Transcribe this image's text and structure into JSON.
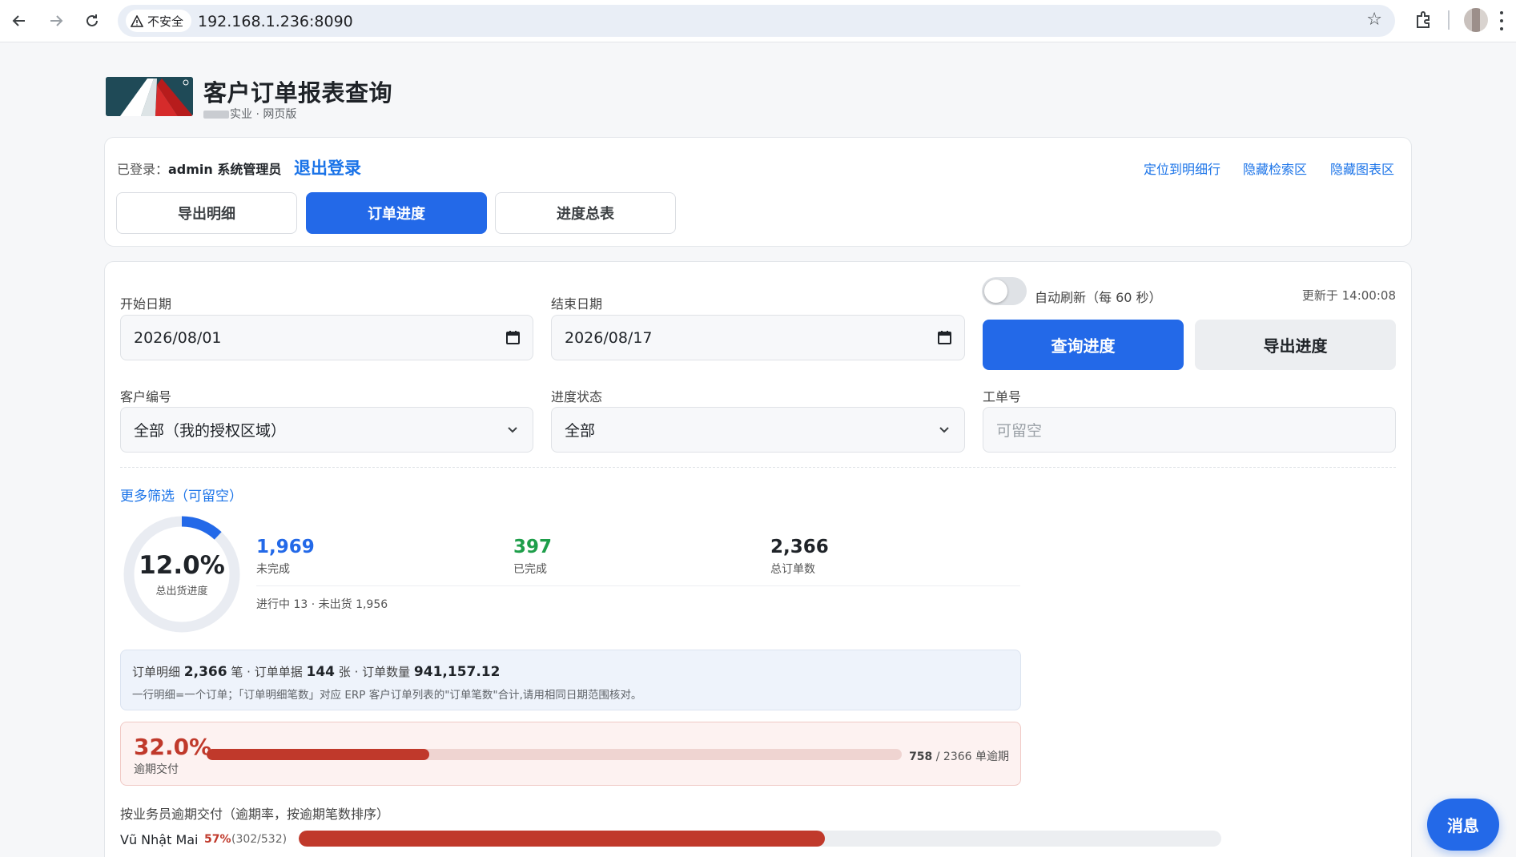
{
  "browser": {
    "security_label": "不安全",
    "url": "192.168.1.236:8090"
  },
  "header": {
    "title": "客户订单报表查询",
    "subtitle": "实业 · 网页版"
  },
  "login": {
    "label": "已登录：",
    "user": "admin 系统管理员",
    "logout": "退出登录"
  },
  "top_links": [
    "定位到明细行",
    "隐藏检索区",
    "隐藏图表区"
  ],
  "tabs": [
    {
      "label": "导出明细",
      "active": false
    },
    {
      "label": "订单进度",
      "active": true
    },
    {
      "label": "进度总表",
      "active": false
    }
  ],
  "form": {
    "start_date_label": "开始日期",
    "start_date": "2026/08/01",
    "end_date_label": "结束日期",
    "end_date": "2026/08/17",
    "auto_refresh_label": "自动刷新（每 60 秒）",
    "updated_at": "更新于 14:00:08",
    "query_button": "查询进度",
    "export_button": "导出进度",
    "customer_label": "客户编号",
    "customer_value": "全部（我的授权区域）",
    "status_label": "进度状态",
    "status_value": "全部",
    "work_order_label": "工单号",
    "work_order_placeholder": "可留空",
    "more_filters": "更多筛选（可留空）"
  },
  "summary": {
    "overall_pct": "12.0%",
    "overall_fraction": 0.12,
    "overall_label": "总出货进度",
    "stats": [
      {
        "value": "1,969",
        "label": "未完成",
        "color": "#2369e8"
      },
      {
        "value": "397",
        "label": "已完成",
        "color": "#1e9e4a"
      },
      {
        "value": "2,366",
        "label": "总订单数",
        "color": "#1f2328"
      }
    ],
    "in_progress": "进行中 13 · 未出货 1,956"
  },
  "info": {
    "detail_label": "订单明细",
    "detail_value": "2,366",
    "detail_unit": "笔",
    "doc_label": "订单单据",
    "doc_value": "144",
    "doc_unit": "张",
    "qty_label": "订单数量",
    "qty_value": "941,157.12",
    "note": "一行明细=一个订单；「订单明细笔数」对应 ERP 客户订单列表的\"订单笔数\"合计,请用相同日期范围核对。"
  },
  "overdue": {
    "pct": "32.0%",
    "label": "逾期交付",
    "fraction": 0.32,
    "count": "758",
    "total_text": "/ 2366 单逾期"
  },
  "sales": {
    "title": "按业务员逾期交付（逾期率，按逾期笔数排序）",
    "rows": [
      {
        "name": "Vũ Nhật Mai",
        "pct": "57%",
        "count": "(302/532)",
        "fraction": 0.57
      }
    ]
  },
  "message_button": "消息",
  "colors": {
    "primary": "#2369e8",
    "danger": "#c0392b",
    "success": "#1e9e4a"
  }
}
